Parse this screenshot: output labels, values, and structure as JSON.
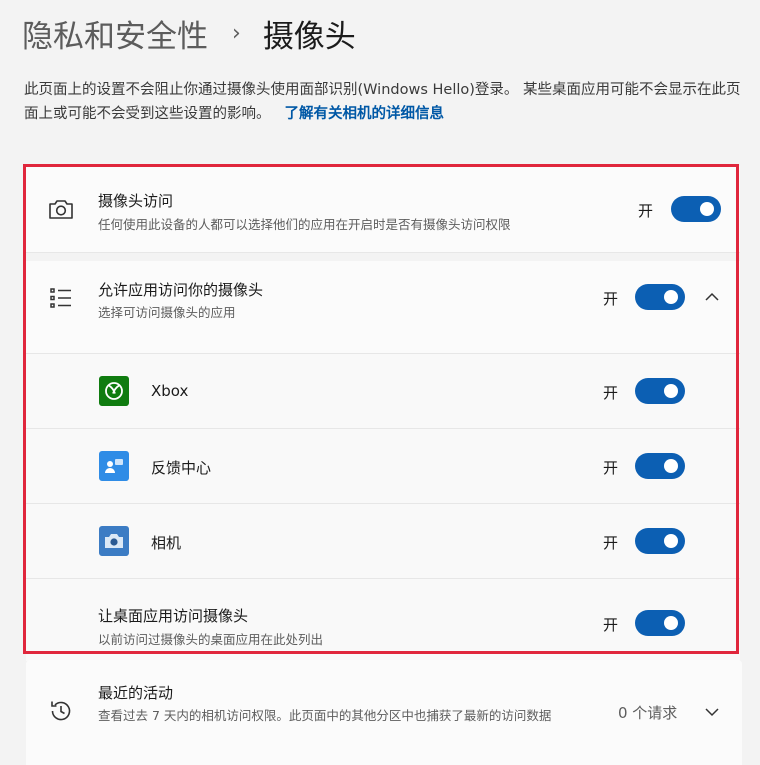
{
  "breadcrumb": {
    "parent": "隐私和安全性",
    "separator": "›",
    "current": "摄像头"
  },
  "description": {
    "text": "此页面上的设置不会阻止你通过摄像头使用面部识别(Windows Hello)登录。 某些桌面应用可能不会显示在此页面上或可能不会受到这些设置的影响。",
    "link": "了解有关相机的详细信息"
  },
  "camera_access": {
    "title": "摄像头访问",
    "subtitle": "任何使用此设备的人都可以选择他们的应用在开启时是否有摄像头访问权限",
    "state": "开",
    "on": true
  },
  "app_access": {
    "title": "允许应用访问你的摄像头",
    "subtitle": "选择可访问摄像头的应用",
    "state": "开",
    "on": true
  },
  "apps": [
    {
      "name": "Xbox",
      "state": "开",
      "on": true,
      "icon": "xbox-icon",
      "color": "#107c10"
    },
    {
      "name": "反馈中心",
      "state": "开",
      "on": true,
      "icon": "feedback-hub-icon",
      "color": "#2f8ce6"
    },
    {
      "name": "相机",
      "state": "开",
      "on": true,
      "icon": "camera-app-icon",
      "color": "#3c7cc4"
    }
  ],
  "desktop_access": {
    "title": "让桌面应用访问摄像头",
    "subtitle": "以前访问过摄像头的桌面应用在此处列出",
    "state": "开",
    "on": true
  },
  "recent_activity": {
    "title": "最近的活动",
    "subtitle": "查看过去 7 天内的相机访问权限。此页面中的其他分区中也捕获了最新的访问数据",
    "count": "0 个请求"
  },
  "colors": {
    "accent": "#0c5fb3",
    "highlight": "#e0263c"
  }
}
